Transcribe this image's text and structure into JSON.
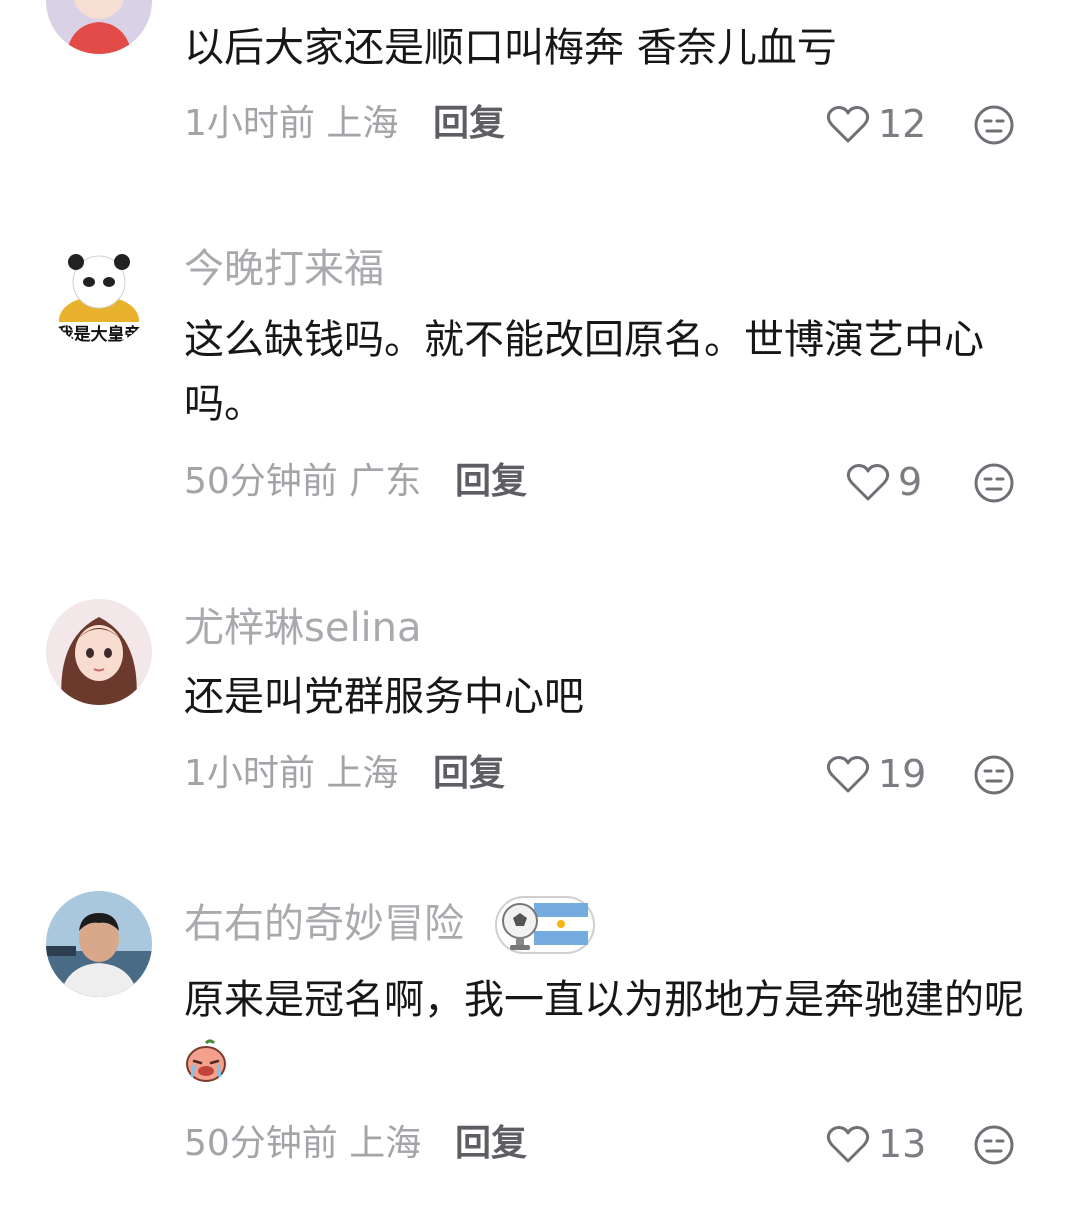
{
  "comments": [
    {
      "avatar": "cartoon-boy-avatar",
      "text": "以后大家还是顺口叫梅奔 香奈儿血亏",
      "time_location": "1小时前 上海",
      "reply_label": "回复",
      "likes": "12"
    },
    {
      "username": "今晚打来福",
      "avatar": "panda-meme-avatar",
      "avatar_caption": "我是大皇帝",
      "text": "这么缺钱吗。就不能改回原名。世博演艺中心吗。",
      "time_location": "50分钟前 广东",
      "reply_label": "回复",
      "likes": "9"
    },
    {
      "username": "尤梓琳selina",
      "avatar": "anime-girl-avatar",
      "text": "还是叫党群服务中心吧",
      "time_location": "1小时前 上海",
      "reply_label": "回复",
      "likes": "19"
    },
    {
      "username": "右右的奇妙冒险",
      "avatar": "man-photo-avatar",
      "badge": "argentina-football-badge",
      "text": "原来是冠名啊，我一直以为那地方是奔驰建的呢",
      "inline_emoji": "crying-face-emoji",
      "time_location": "50分钟前 上海",
      "reply_label": "回复",
      "likes": "13"
    }
  ],
  "icons": {
    "like": "heart-outline-icon",
    "emoji": "face-emoji-icon"
  },
  "colors": {
    "username": "#a9aaae",
    "text": "#171718",
    "meta": "#a3a4a8",
    "reply": "#5d5e63"
  }
}
